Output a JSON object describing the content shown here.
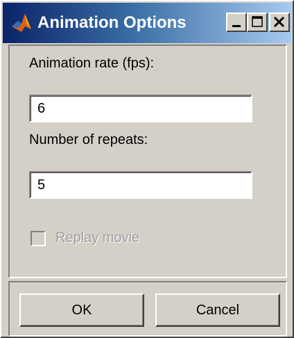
{
  "window": {
    "title": "Animation Options",
    "icon": "matlab-logo-icon",
    "controls": [
      "minimize-icon",
      "maximize-icon",
      "close-icon"
    ]
  },
  "form": {
    "rate_label": "Animation rate (fps):",
    "rate_value": "6",
    "repeats_label": "Number of repeats:",
    "repeats_value": "5",
    "replay_label": "Replay movie",
    "replay_checked": false,
    "replay_enabled": false
  },
  "buttons": {
    "ok_label": "OK",
    "cancel_label": "Cancel"
  },
  "colors": {
    "titlebar_start": "#0a246a",
    "titlebar_end": "#a6caf0",
    "face": "#d4d0c8",
    "disabled_text": "#a0a0a0"
  }
}
